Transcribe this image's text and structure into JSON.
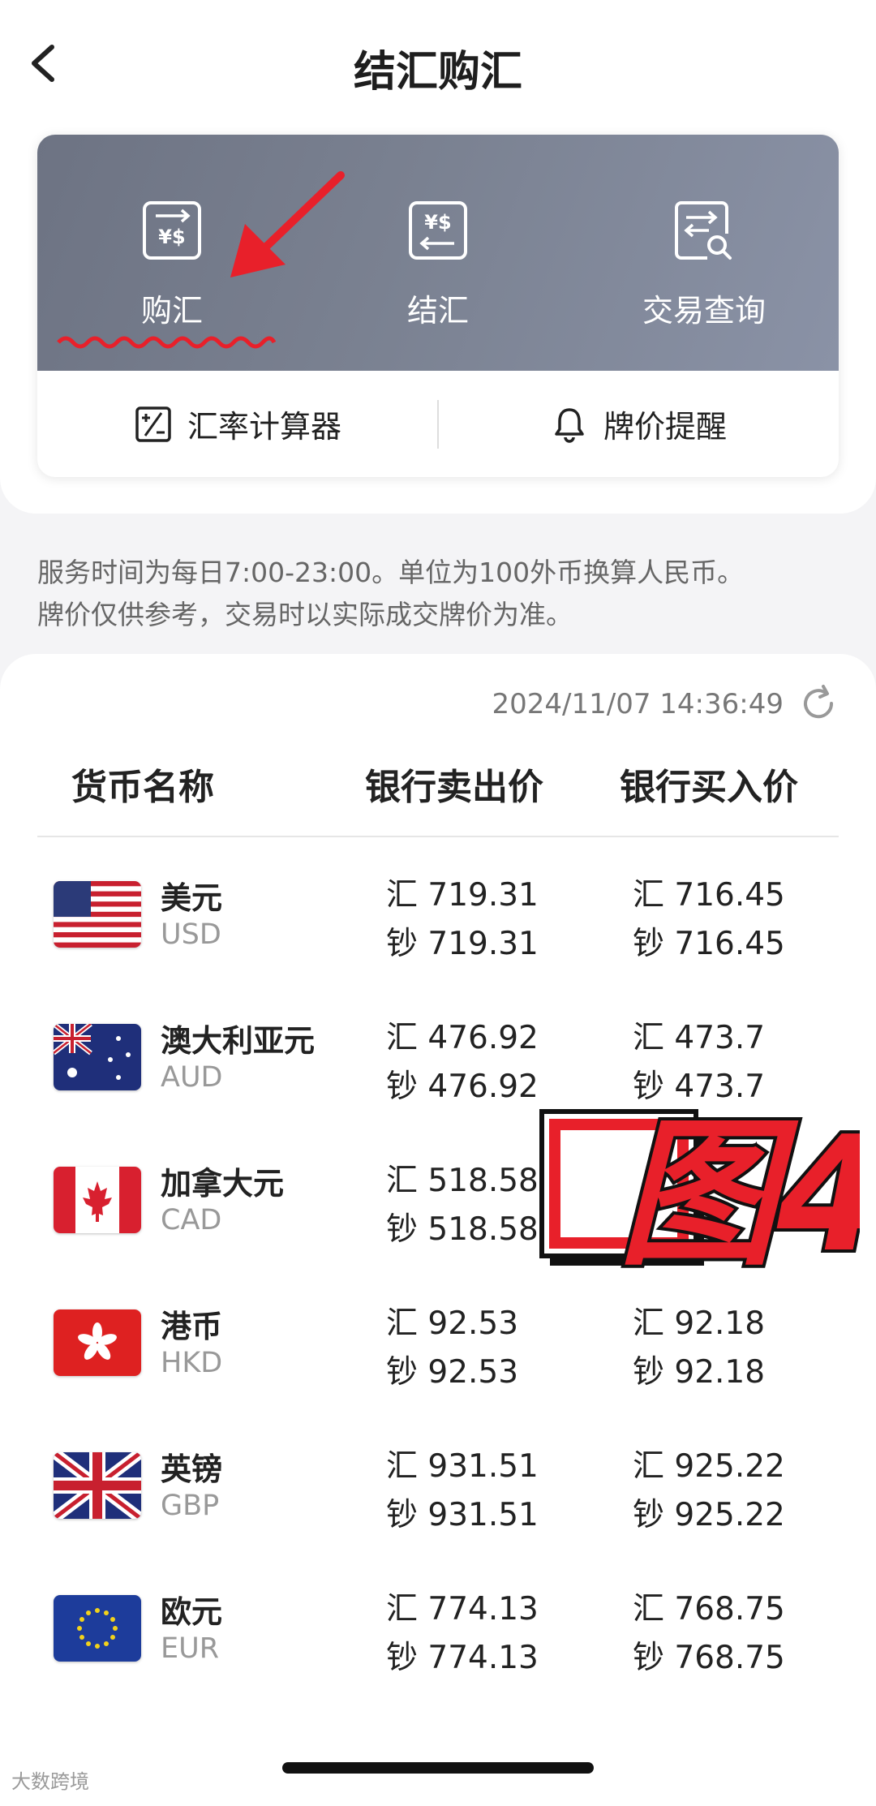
{
  "header": {
    "title": "结汇购汇"
  },
  "functions": [
    {
      "label": "购汇",
      "icon": "currency-exchange-icon"
    },
    {
      "label": "结汇",
      "icon": "currency-settle-icon"
    },
    {
      "label": "交易查询",
      "icon": "transaction-search-icon"
    }
  ],
  "tools": [
    {
      "label": "汇率计算器",
      "icon": "calculator-icon"
    },
    {
      "label": "牌价提醒",
      "icon": "bell-icon"
    }
  ],
  "notice": {
    "line1": "服务时间为每日7:00-23:00。单位为100外币换算人民币。",
    "line2": "牌价仅供参考，交易时以实际成交牌价为准。"
  },
  "rates": {
    "timestamp": "2024/11/07 14:36:49",
    "columns": [
      "货币名称",
      "银行卖出价",
      "银行买入价"
    ],
    "rows": [
      {
        "name": "美元",
        "code": "USD",
        "sell_spot": "汇 719.31",
        "sell_cash": "钞 719.31",
        "buy_spot": "汇 716.45",
        "buy_cash": "钞 716.45"
      },
      {
        "name": "澳大利亚元",
        "code": "AUD",
        "sell_spot": "汇 476.92",
        "sell_cash": "钞 476.92",
        "buy_spot": "汇 473.7",
        "buy_cash": "钞 473.7"
      },
      {
        "name": "加拿大元",
        "code": "CAD",
        "sell_spot": "汇 518.58",
        "sell_cash": "钞 518.58",
        "buy_spot": "",
        "buy_cash": ""
      },
      {
        "name": "港币",
        "code": "HKD",
        "sell_spot": "汇 92.53",
        "sell_cash": "钞 92.53",
        "buy_spot": "汇 92.18",
        "buy_cash": "钞 92.18"
      },
      {
        "name": "英镑",
        "code": "GBP",
        "sell_spot": "汇 931.51",
        "sell_cash": "钞 931.51",
        "buy_spot": "汇 925.22",
        "buy_cash": "钞 925.22"
      },
      {
        "name": "欧元",
        "code": "EUR",
        "sell_spot": "汇 774.13",
        "sell_cash": "钞 774.13",
        "buy_spot": "汇 768.75",
        "buy_cash": "钞 768.75"
      }
    ]
  },
  "annotation": {
    "stamp_text": "图4"
  },
  "watermark": "大数跨境",
  "colors": {
    "banner": "#7a8191",
    "annotation_red": "#e8202a"
  }
}
